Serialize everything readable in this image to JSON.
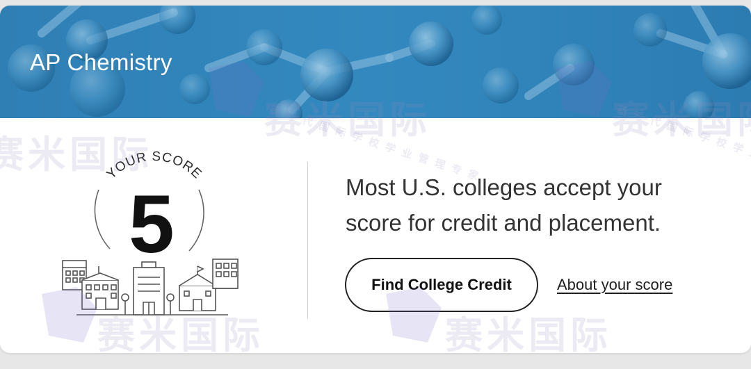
{
  "course": {
    "title": "AP Chemistry"
  },
  "score": {
    "label": "YOUR SCORE",
    "value": "5"
  },
  "message": "Most U.S. colleges accept your score for credit and placement.",
  "actions": {
    "find_college_credit": "Find College Credit",
    "about_your_score": "About your score"
  },
  "watermark": {
    "brand": "赛米国际",
    "tagline": "新一代国际学校学业管理专家"
  },
  "colors": {
    "banner": "#2f84b9",
    "banner_dark": "#1e5f8c",
    "card": "#ffffff",
    "text": "#333333"
  }
}
